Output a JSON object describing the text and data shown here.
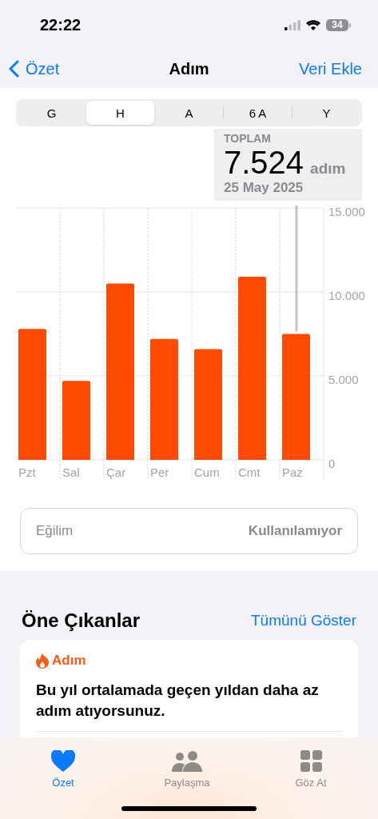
{
  "status_bar": {
    "time": "22:22",
    "battery": "34"
  },
  "nav": {
    "back": "Özet",
    "title": "Adım",
    "action": "Veri Ekle"
  },
  "segments": [
    {
      "label": "G",
      "selected": false
    },
    {
      "label": "H",
      "selected": true
    },
    {
      "label": "A",
      "selected": false
    },
    {
      "label": "6 A",
      "selected": false
    },
    {
      "label": "Y",
      "selected": false
    }
  ],
  "callout": {
    "label": "TOPLAM",
    "value": "7.524",
    "unit": "adım",
    "date": "25 May 2025"
  },
  "chart_data": {
    "type": "bar",
    "categories": [
      "Pzt",
      "Sal",
      "Çar",
      "Per",
      "Cum",
      "Cmt",
      "Paz"
    ],
    "values": [
      7800,
      4700,
      10500,
      7200,
      6600,
      10900,
      7500
    ],
    "ylim": [
      0,
      15000
    ],
    "yticks": [
      {
        "value": 0,
        "label": "0"
      },
      {
        "value": 5000,
        "label": "5.000"
      },
      {
        "value": 10000,
        "label": "10.000"
      },
      {
        "value": 15000,
        "label": "15.000"
      }
    ]
  },
  "trend": {
    "label": "Eğilim",
    "value": "Kullanılamıyor"
  },
  "highlights": {
    "title": "Öne Çıkanlar",
    "link": "Tümünü Göster",
    "card": {
      "category": "Adım",
      "text": "Bu yıl ortalamada geçen yıldan daha az adım atıyorsunuz."
    }
  },
  "tab_bar": [
    {
      "kind": "heart",
      "label": "Özet",
      "selected": true
    },
    {
      "kind": "people",
      "label": "Paylaşma",
      "selected": false
    },
    {
      "kind": "grid",
      "label": "Göz At",
      "selected": false
    }
  ]
}
